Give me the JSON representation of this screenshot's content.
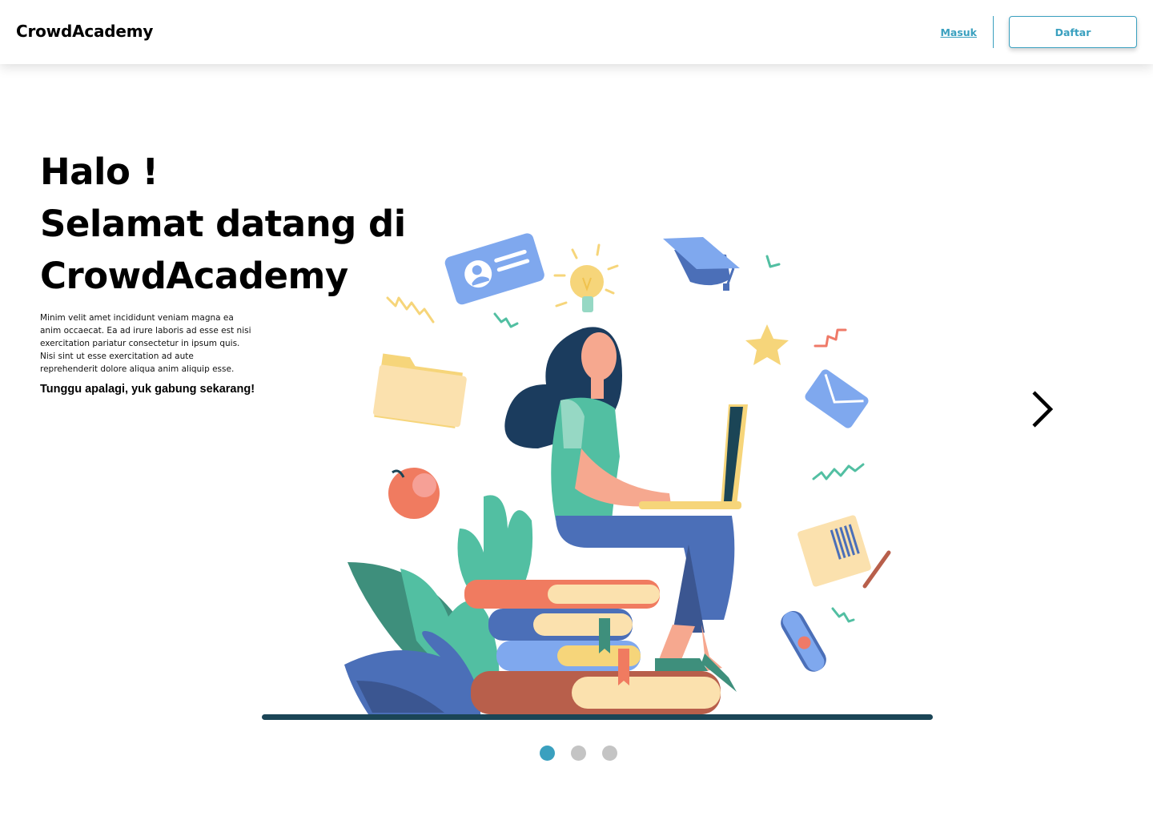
{
  "navbar": {
    "brand": "CrowdAcademy",
    "login_label": "Masuk",
    "register_label": "Daftar"
  },
  "hero": {
    "title_line1": "Halo !",
    "title_line2": "Selamat datang di",
    "title_line3": "CrowdAcademy",
    "description": "Minim velit amet incididunt veniam magna ea anim occaecat. Ea ad irure laboris ad esse est nisi exercitation pariatur consectetur in ipsum quis. Nisi sint ut esse exercitation ad aute reprehenderit dolore aliqua anim aliquip esse.",
    "cta": "Tunggu apalagi, yuk gabung sekarang!"
  },
  "carousel": {
    "next_icon": "chevron-right-icon",
    "slides": 3,
    "active_slide": 1
  },
  "colors": {
    "accent": "#3aa0bf",
    "dot_inactive": "#c4c4c4",
    "text": "#000000"
  }
}
